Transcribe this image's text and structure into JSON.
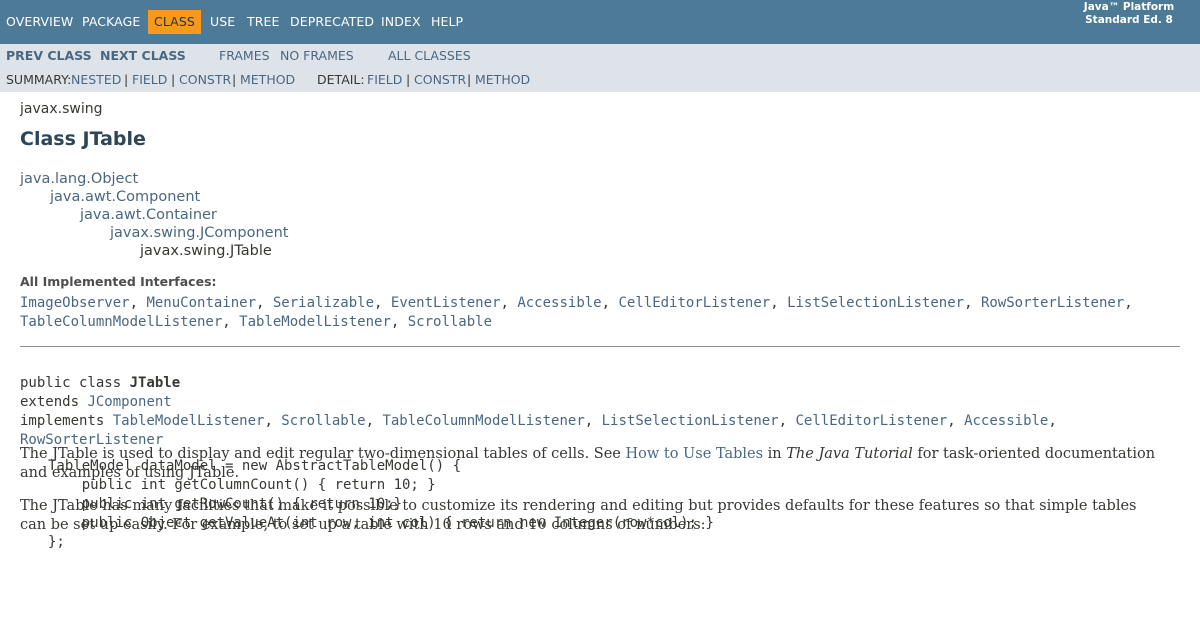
{
  "topnav": {
    "items": [
      "OVERVIEW",
      "PACKAGE",
      "CLASS",
      "USE",
      "TREE",
      "DEPRECATED",
      "INDEX",
      "HELP"
    ],
    "active": "CLASS",
    "platform_line1": "Java™ Platform",
    "platform_line2": "Standard Ed. 8",
    "colors": {
      "bar": "#4d7a97",
      "active": "#f8981d"
    }
  },
  "subnav": {
    "prev_class": "PREV CLASS",
    "next_class": "NEXT CLASS",
    "frames": "FRAMES",
    "no_frames": "NO FRAMES",
    "all_classes": "ALL CLASSES",
    "summary_label": "SUMMARY:",
    "summary_nested": "NESTED",
    "summary_field": "FIELD",
    "summary_constr": "CONSTR",
    "summary_method": "METHOD",
    "detail_label": "DETAIL:",
    "detail_field": "FIELD",
    "detail_constr": "CONSTR",
    "detail_method": "METHOD",
    "separator": "|"
  },
  "page": {
    "package": "javax.swing",
    "title": "Class JTable",
    "inheritance": [
      "java.lang.Object",
      "java.awt.Component",
      "java.awt.Container",
      "javax.swing.JComponent",
      "javax.swing.JTable"
    ]
  },
  "interfaces": {
    "label": "All Implemented Interfaces:",
    "items": [
      "ImageObserver",
      "MenuContainer",
      "Serializable",
      "EventListener",
      "Accessible",
      "CellEditorListener",
      "ListSelectionListener",
      "RowSorterListener",
      "TableColumnModelListener",
      "TableModelListener",
      "Scrollable"
    ]
  },
  "declaration": {
    "line1_prefix": "public class ",
    "class_name": "JTable",
    "extends_prefix": "extends ",
    "extends_class": "JComponent",
    "implements_prefix": "implements ",
    "implements": [
      "TableModelListener",
      "Scrollable",
      "TableColumnModelListener",
      "ListSelectionListener",
      "CellEditorListener",
      "Accessible",
      "RowSorterListener"
    ]
  },
  "description": {
    "p1_a": "The ",
    "p1_code": "JTable",
    "p1_b": " is used to display and edit regular two-dimensional tables of cells. See ",
    "p1_link": "How to Use Tables",
    "p1_c": " in ",
    "p1_ital": "The Java Tutorial",
    "p1_d": " for task-oriented documentation and examples of using ",
    "p1_code2": "JTable",
    "p1_e": ".",
    "p2_a": "The ",
    "p2_code": "JTable",
    "p2_b": " has many facilities that make it possible to customize its rendering and editing but provides defaults for these features so that simple tables can be set up easily. For example, to set up a table with 10 rows and 10 columns of numbers:",
    "code_lines": [
      "TableModel dataModel = new AbstractTableModel() {",
      "    public int getColumnCount() { return 10; }",
      "    public int getRowCount() { return 10;}",
      "    public Object getValueAt(int row, int col) { return new Integer(row*col); }",
      "};"
    ]
  }
}
